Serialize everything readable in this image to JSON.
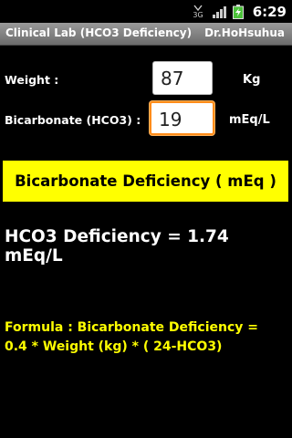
{
  "status_bar": {
    "network": "3G",
    "time": "6:29",
    "icons": [
      "network-3g-icon",
      "signal-strength-icon",
      "battery-charging-icon"
    ]
  },
  "title_bar": {
    "title": "Clinical Lab (HCO3 Deficiency)",
    "author": "Dr.HoHsuhua"
  },
  "form": {
    "weight_label": "Weight :",
    "weight_value": "87",
    "weight_unit": "Kg",
    "bicarbonate_label": "Bicarbonate (HCO3) :",
    "bicarbonate_value": "19",
    "bicarbonate_unit": "mEq/L"
  },
  "calculate_button": {
    "label": "Bicarbonate Deficiency ( mEq )"
  },
  "result": {
    "text": "HCO3 Deficiency = 1.74 mEq/L"
  },
  "formula": {
    "line1": "Formula : Bicarbonate Deficiency =",
    "line2": "0.4 * Weight (kg) * ( 24-HCO3)"
  },
  "colors": {
    "background": "#000000",
    "accent_yellow": "#ffff00",
    "focus_orange": "#ff8c1a",
    "title_bar_gray": "#7f7f7f"
  }
}
